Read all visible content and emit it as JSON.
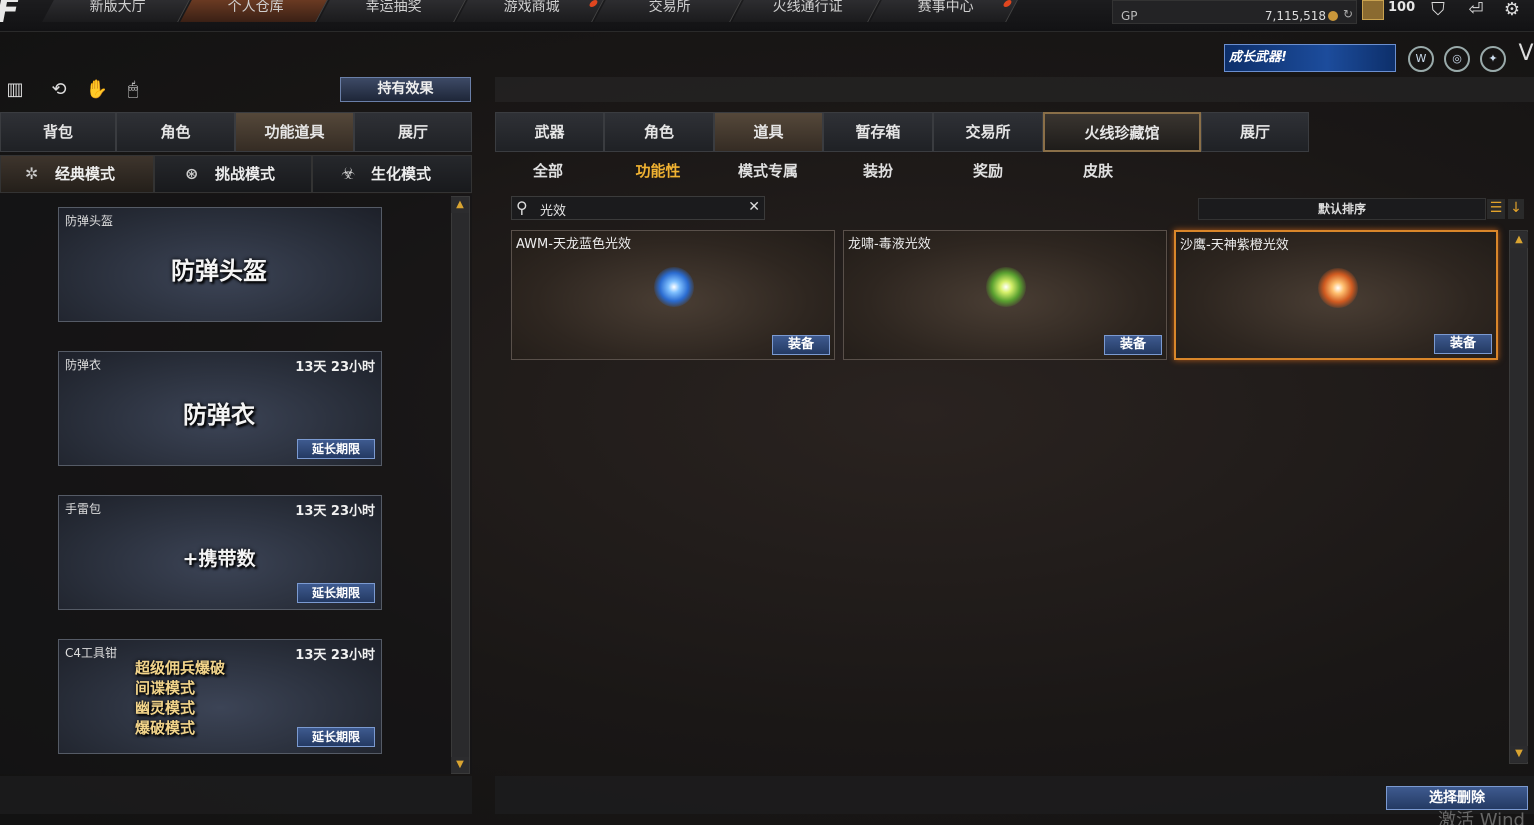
{
  "nav": {
    "tabs": [
      "新版大厅",
      "个人仓库",
      "幸运抽奖",
      "游戏商城",
      "交易所",
      "火线通行证",
      "赛事中心"
    ],
    "active_index": 1
  },
  "currency": {
    "gp_label": "GP",
    "gp_value": "7,115,518"
  },
  "level": "100",
  "banner": {
    "growth_weapon": "成长武器!"
  },
  "toolbar": {
    "effect_button": "持有效果"
  },
  "left_tabs": [
    "背包",
    "角色",
    "功能道具",
    "展厅"
  ],
  "left_active": 2,
  "mode_tabs": [
    {
      "label": "经典模式",
      "icon": "star-icon"
    },
    {
      "label": "挑战模式",
      "icon": "challenge-icon"
    },
    {
      "label": "生化模式",
      "icon": "biohazard-icon"
    }
  ],
  "left_items": [
    {
      "name": "防弹头盔",
      "time": "",
      "art": "防弹头盔",
      "extend": ""
    },
    {
      "name": "防弹衣",
      "time": "13天 23小时",
      "art": "防弹衣",
      "extend": "延长期限"
    },
    {
      "name": "手雷包",
      "time": "13天 23小时",
      "art": "+携带数",
      "extend": "延长期限"
    },
    {
      "name": "C4工具钳",
      "time": "13天 23小时",
      "art_lines": [
        "超级佣兵爆破",
        "间谍模式",
        "幽灵模式",
        "爆破模式"
      ],
      "extend": "延长期限"
    }
  ],
  "right_tabs": [
    "武器",
    "角色",
    "道具",
    "暂存箱",
    "交易所",
    "火线珍藏馆",
    "展厅"
  ],
  "right_active": 2,
  "sub_tabs": [
    "全部",
    "功能性",
    "模式专属",
    "装扮",
    "奖励",
    "皮肤"
  ],
  "sub_active": 1,
  "search": {
    "value": "光效"
  },
  "sort": {
    "label": "默认排序"
  },
  "effects": [
    {
      "name": "AWM-天龙蓝色光效",
      "button": "装备",
      "color": "#3f8ff0"
    },
    {
      "name": "龙啸-毒液光效",
      "button": "装备",
      "color": "#6fb83a"
    },
    {
      "name": "沙鹰-天神紫橙光效",
      "button": "装备",
      "color": "#e07a2a"
    }
  ],
  "actions": {
    "delete": "选择删除"
  },
  "watermark": "激活 Wind"
}
